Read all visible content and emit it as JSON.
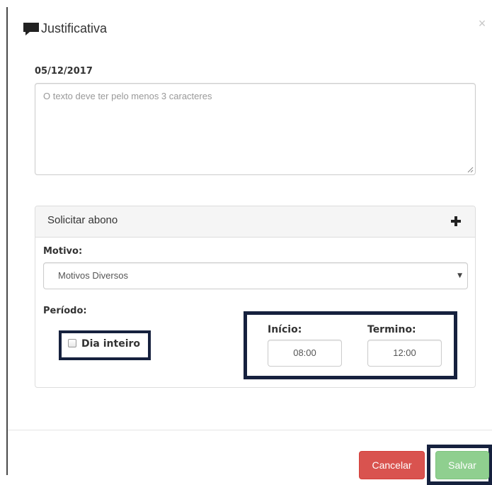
{
  "modal": {
    "title": "Justificativa",
    "title_icon": "comment-icon",
    "close_symbol": "×"
  },
  "justification": {
    "date": "05/12/2017",
    "placeholder": "O texto deve ter pelo menos 3 caracteres",
    "value": ""
  },
  "abono_panel": {
    "title": "Solicitar abono",
    "add_icon": "plus-icon",
    "motivo_label": "Motivo:",
    "motivo_selected": "Motivos Diversos",
    "periodo_label": "Período:",
    "dia_inteiro_label": "Dia inteiro",
    "dia_inteiro_checked": false,
    "inicio_label": "Início:",
    "inicio_value": "08:00",
    "termino_label": "Termino:",
    "termino_value": "12:00"
  },
  "footer": {
    "cancel_label": "Cancelar",
    "save_label": "Salvar"
  },
  "colors": {
    "cancel": "#d9534f",
    "save": "#8fcf8f",
    "highlight_frame": "#16213e",
    "panel_heading": "#f5f5f5"
  }
}
